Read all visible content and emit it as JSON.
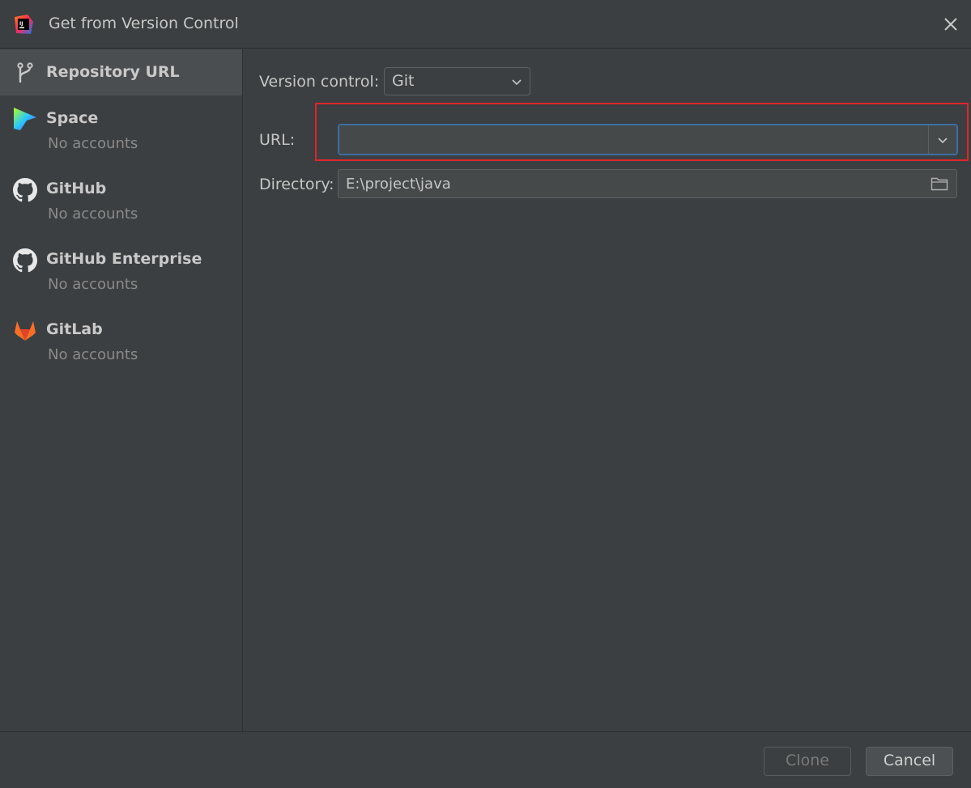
{
  "window": {
    "title": "Get from Version Control",
    "app_icon": "intellij-idea-icon",
    "close_icon": "close-icon"
  },
  "sidebar": {
    "items": [
      {
        "label": "Repository URL",
        "sub": "",
        "icon": "vcs-branch-icon",
        "selected": true
      },
      {
        "label": "Space",
        "sub": "No accounts",
        "icon": "space-logo-icon"
      },
      {
        "label": "GitHub",
        "sub": "No accounts",
        "icon": "github-icon"
      },
      {
        "label": "GitHub Enterprise",
        "sub": "No accounts",
        "icon": "github-icon"
      },
      {
        "label": "GitLab",
        "sub": "No accounts",
        "icon": "gitlab-icon"
      }
    ]
  },
  "form": {
    "version_control_label": "Version control:",
    "version_control_value": "Git",
    "url_label": "URL:",
    "url_value": "",
    "directory_label": "Directory:",
    "directory_value": "E:\\project\\java"
  },
  "buttons": {
    "clone": "Clone",
    "cancel": "Cancel"
  },
  "colors": {
    "background": "#3c3f41",
    "selected_item": "#4b4e51",
    "focus_border": "#3d6fa3",
    "highlight_annotation": "#e0242b"
  }
}
